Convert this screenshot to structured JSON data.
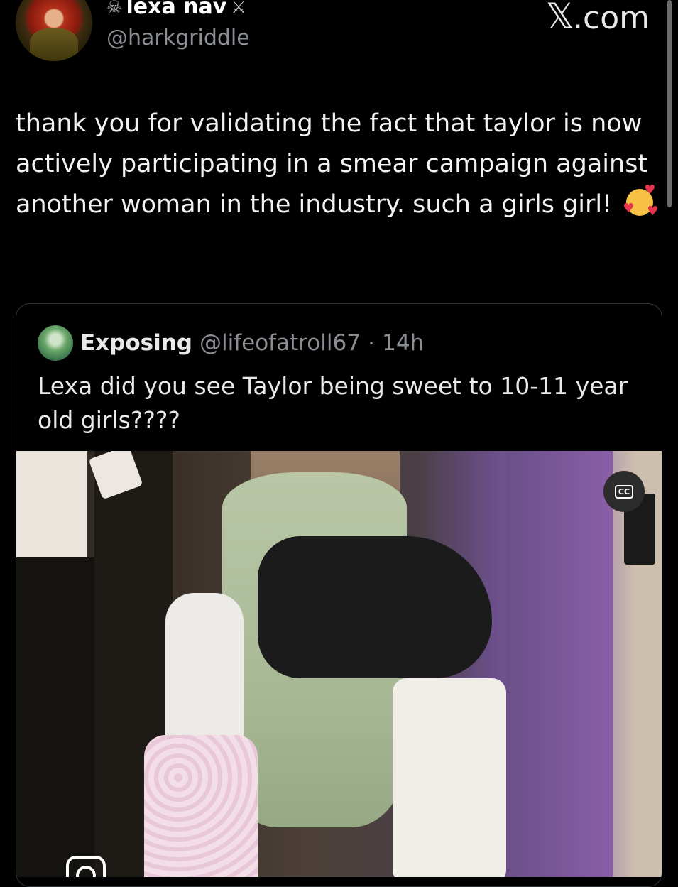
{
  "author": {
    "display_name": "lexa nav",
    "prefix_symbol": "☠",
    "suffix_symbol": "⚔",
    "handle": "@harkgriddle"
  },
  "brand": {
    "mark": "𝕏",
    "domain": ".com"
  },
  "post": {
    "text": "thank you for validating the fact that taylor is now actively participating in a smear campaign against another woman in the industry. such a girls girl!",
    "emoji": "smiling-face-with-hearts"
  },
  "quote": {
    "name": "Exposing",
    "handle": "@lifeofatroll67",
    "separator": "·",
    "time": "14h",
    "text": "Lexa did you see Taylor being sweet to 10-11 year old girls????"
  },
  "media": {
    "cc_label": "CC",
    "colors": {
      "skirt": "#a9b996",
      "wall": "#8a5fa8",
      "shirt": "#1b1b1b",
      "pants": "#f1eee8",
      "floral": "#e8c8d8"
    }
  },
  "icons": [
    "avatar-image",
    "quote-avatar-image",
    "captions-icon",
    "instagram-icon",
    "smiling-face-with-hearts-emoji"
  ]
}
